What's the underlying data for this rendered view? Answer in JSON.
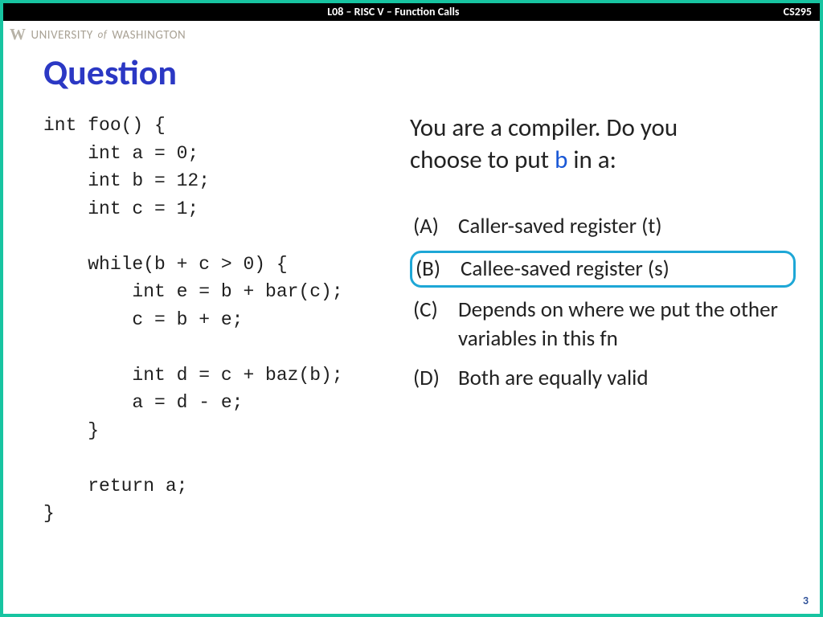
{
  "header": {
    "center": "L08 – RISC V – Function Calls",
    "right": "CS295"
  },
  "university": {
    "logo": "W",
    "name_part1": "UNIVERSITY",
    "of": "of",
    "name_part2": "WASHINGTON"
  },
  "title": "Question",
  "code": "int foo() {\n    int a = 0;\n    int b = 12;\n    int c = 1;\n\n    while(b + c > 0) {\n        int e = b + bar(c);\n        c = b + e;\n\n        int d = c + baz(b);\n        a = d - e;\n    }\n\n    return a;\n}",
  "prompt": {
    "line1": "You are a compiler. Do you",
    "line2_pre": "choose to put ",
    "var": "b",
    "line2_post": " in a:"
  },
  "options": [
    {
      "letter": "(A)",
      "text": "Caller-saved register (t)",
      "highlighted": false
    },
    {
      "letter": "(B)",
      "text": "Callee-saved register (s)",
      "highlighted": true
    },
    {
      "letter": "(C)",
      "text": "Depends on where we put the other variables in this fn",
      "highlighted": false
    },
    {
      "letter": "(D)",
      "text": "Both are equally valid",
      "highlighted": false
    }
  ],
  "page_number": "3"
}
